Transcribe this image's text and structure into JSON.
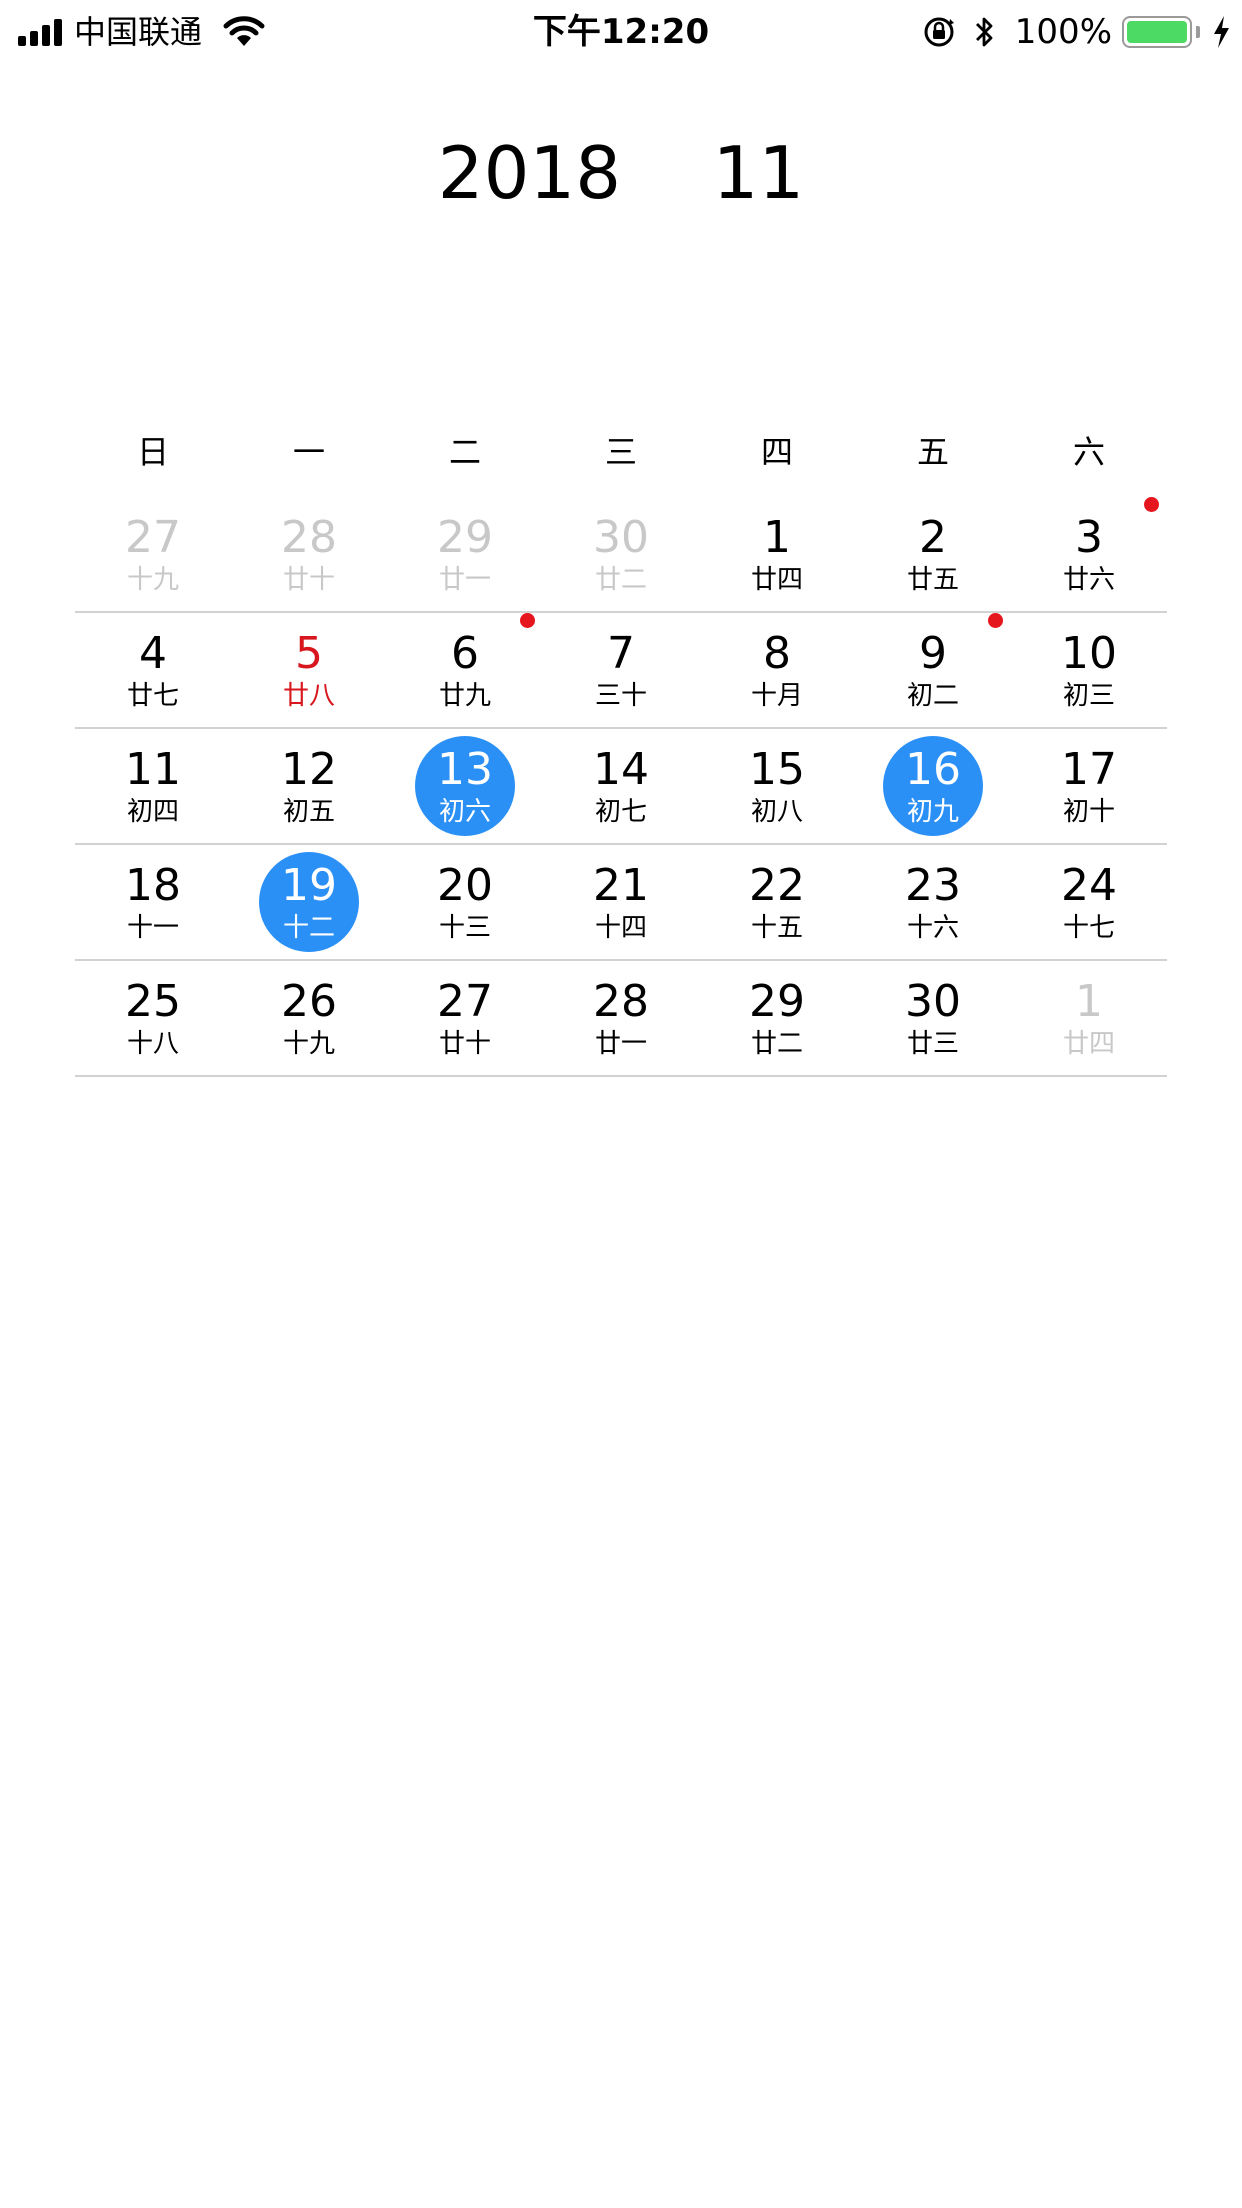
{
  "status_bar": {
    "carrier": "中国联通",
    "time": "下午12:20",
    "battery_percent": "100%",
    "battery_level": 1.0,
    "icons": [
      "signal-icon",
      "wifi-icon",
      "orientation-lock-icon",
      "bluetooth-icon",
      "battery-icon",
      "charging-icon"
    ],
    "battery_color": "#4cd964"
  },
  "calendar": {
    "title": "2018    11",
    "weekdays": [
      "日",
      "一",
      "二",
      "三",
      "四",
      "五",
      "六"
    ],
    "colors": {
      "selected": "#2b90f5",
      "holiday": "#d8161d",
      "muted": "#c8c8c8",
      "event_dot": "#e5161d"
    },
    "weeks": [
      [
        {
          "day": "27",
          "lunar": "十九",
          "state": "muted"
        },
        {
          "day": "28",
          "lunar": "廿十",
          "state": "muted"
        },
        {
          "day": "29",
          "lunar": "廿一",
          "state": "muted"
        },
        {
          "day": "30",
          "lunar": "廿二",
          "state": "muted"
        },
        {
          "day": "1",
          "lunar": "廿四",
          "state": "normal"
        },
        {
          "day": "2",
          "lunar": "廿五",
          "state": "normal"
        },
        {
          "day": "3",
          "lunar": "廿六",
          "state": "normal",
          "event": true
        }
      ],
      [
        {
          "day": "4",
          "lunar": "廿七",
          "state": "normal"
        },
        {
          "day": "5",
          "lunar": "廿八",
          "state": "holiday"
        },
        {
          "day": "6",
          "lunar": "廿九",
          "state": "normal",
          "event": true
        },
        {
          "day": "7",
          "lunar": "三十",
          "state": "normal"
        },
        {
          "day": "8",
          "lunar": "十月",
          "state": "normal"
        },
        {
          "day": "9",
          "lunar": "初二",
          "state": "normal",
          "event": true
        },
        {
          "day": "10",
          "lunar": "初三",
          "state": "normal"
        }
      ],
      [
        {
          "day": "11",
          "lunar": "初四",
          "state": "normal"
        },
        {
          "day": "12",
          "lunar": "初五",
          "state": "normal"
        },
        {
          "day": "13",
          "lunar": "初六",
          "state": "selected"
        },
        {
          "day": "14",
          "lunar": "初七",
          "state": "normal"
        },
        {
          "day": "15",
          "lunar": "初八",
          "state": "normal"
        },
        {
          "day": "16",
          "lunar": "初九",
          "state": "selected"
        },
        {
          "day": "17",
          "lunar": "初十",
          "state": "normal"
        }
      ],
      [
        {
          "day": "18",
          "lunar": "十一",
          "state": "normal"
        },
        {
          "day": "19",
          "lunar": "十二",
          "state": "selected"
        },
        {
          "day": "20",
          "lunar": "十三",
          "state": "normal"
        },
        {
          "day": "21",
          "lunar": "十四",
          "state": "normal"
        },
        {
          "day": "22",
          "lunar": "十五",
          "state": "normal"
        },
        {
          "day": "23",
          "lunar": "十六",
          "state": "normal"
        },
        {
          "day": "24",
          "lunar": "十七",
          "state": "normal"
        }
      ],
      [
        {
          "day": "25",
          "lunar": "十八",
          "state": "normal"
        },
        {
          "day": "26",
          "lunar": "十九",
          "state": "normal"
        },
        {
          "day": "27",
          "lunar": "廿十",
          "state": "normal"
        },
        {
          "day": "28",
          "lunar": "廿一",
          "state": "normal"
        },
        {
          "day": "29",
          "lunar": "廿二",
          "state": "normal"
        },
        {
          "day": "30",
          "lunar": "廿三",
          "state": "normal"
        },
        {
          "day": "1",
          "lunar": "廿四",
          "state": "muted"
        }
      ]
    ]
  }
}
